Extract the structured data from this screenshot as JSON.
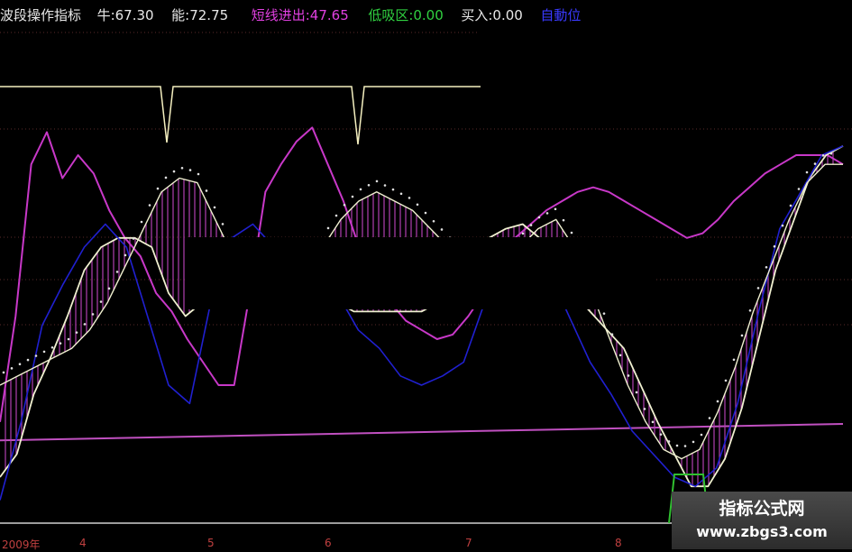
{
  "header": {
    "title": "波段操作指标",
    "bull_label": "牛:",
    "bull_value": "67.30",
    "energy_label": "能:",
    "energy_value": "72.75",
    "short_label": "短线进出:",
    "short_value": "47.65",
    "low_label": "低吸区:",
    "low_value": "0.00",
    "buy_label": "买入:",
    "buy_value": "0.00",
    "trunc_label": "自動位"
  },
  "x_ticks": [
    "2009年",
    "4",
    "5",
    "6",
    "7",
    "8"
  ],
  "watermark": {
    "line1": "指标公式网",
    "line2": "www.zbgs3.com"
  },
  "colors": {
    "background": "#000000",
    "magenta_line": "#c838c8",
    "white_line": "#f0f0d0",
    "blue_line": "#2020d0",
    "dots": "#e0e0e0",
    "hist": "#b040b0",
    "ref_line": "#c050c0",
    "step_line": "#f5f0c0",
    "green_box": "#30c030"
  },
  "chart_data": {
    "type": "line",
    "x_range": [
      0,
      935
    ],
    "ylim": [
      0,
      100
    ],
    "series": [
      {
        "values": [
          22,
          45,
          78,
          85,
          75,
          80,
          76,
          68,
          62,
          58,
          50,
          46,
          40,
          35,
          30,
          30,
          50,
          72,
          78,
          83,
          86,
          78,
          70,
          60,
          50,
          48,
          44,
          42,
          40,
          41,
          45,
          50,
          58,
          62,
          65,
          68,
          70,
          72,
          73,
          72,
          70,
          68,
          66,
          64,
          62,
          63,
          66,
          70,
          73,
          76,
          78,
          80,
          80,
          80,
          78
        ]
      },
      {
        "values": [
          10,
          15,
          28,
          36,
          45,
          55,
          60,
          62,
          62,
          60,
          50,
          45,
          48,
          50,
          55,
          60,
          62,
          60,
          56,
          52,
          48,
          46,
          46,
          46,
          46,
          46,
          48,
          52,
          58,
          62,
          64,
          65,
          62,
          56,
          50,
          46,
          42,
          38,
          30,
          22,
          15,
          8,
          8,
          14,
          25,
          40,
          55,
          65,
          75,
          80,
          82
        ]
      },
      {
        "values": [
          5,
          22,
          43,
          52,
          60,
          65,
          60,
          45,
          30,
          26,
          48,
          62,
          65,
          60,
          55,
          58,
          50,
          42,
          38,
          32,
          30,
          32,
          35,
          48,
          58,
          60,
          55,
          45,
          35,
          28,
          20,
          15,
          10,
          8,
          12,
          26,
          46,
          64,
          72,
          80,
          82
        ]
      },
      {
        "values": [
          30,
          32,
          34,
          36,
          38,
          42,
          48,
          56,
          64,
          72,
          75,
          74,
          66,
          58,
          52,
          48,
          50,
          55,
          60,
          66,
          70,
          72,
          70,
          68,
          64,
          60,
          56,
          54,
          55,
          60,
          64,
          66,
          60,
          50,
          40,
          30,
          22,
          16,
          14,
          16,
          24,
          34,
          46,
          56,
          66,
          74,
          78,
          78
        ]
      }
    ],
    "ref_levels": [
      18
    ]
  }
}
